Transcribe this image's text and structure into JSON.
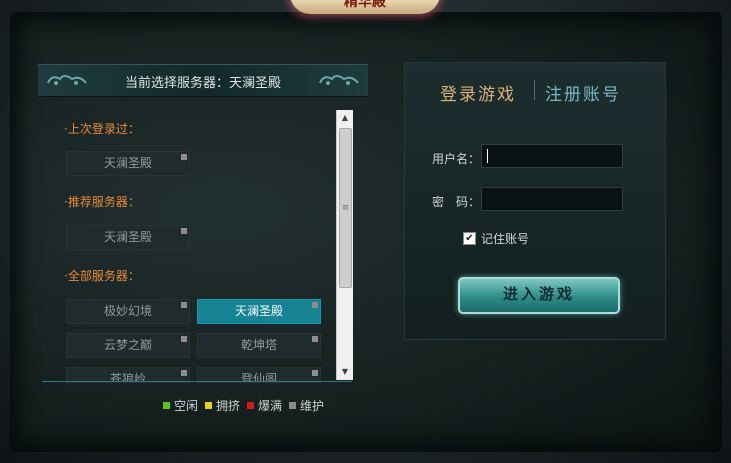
{
  "logo_text": "精华殿",
  "server_panel": {
    "title": "当前选择服务器：天澜圣殿",
    "last_login_label": "·上次登录过：",
    "recommended_label": "·推荐服务器：",
    "all_label": "·全部服务器：",
    "last_login": [
      {
        "name": "天澜圣殿"
      }
    ],
    "recommended": [
      {
        "name": "天澜圣殿"
      }
    ],
    "all_servers": [
      {
        "name": "极妙幻境",
        "selected": false
      },
      {
        "name": "天澜圣殿",
        "selected": true
      },
      {
        "name": "云梦之巅",
        "selected": false
      },
      {
        "name": "乾坤塔",
        "selected": false
      },
      {
        "name": "苍狼岭",
        "selected": false
      },
      {
        "name": "登仙阁",
        "selected": false
      }
    ]
  },
  "legend": [
    {
      "label": "空闲",
      "color": "#5ec21c"
    },
    {
      "label": "拥挤",
      "color": "#e3d21a"
    },
    {
      "label": "爆满",
      "color": "#d61818"
    },
    {
      "label": "维护",
      "color": "#8a8a8a"
    }
  ],
  "login": {
    "tab_login": "登录游戏",
    "tab_register": "注册账号",
    "username_label": "用户名：",
    "username_value": "",
    "password_label": "密　码：",
    "password_value": "",
    "remember_label": "记住账号",
    "remember_checked": true,
    "enter_button": "进入游戏"
  },
  "colors": {
    "accent": "#168394",
    "section_label": "#e88a3a",
    "tab_active": "#d8b27a",
    "tab_inactive": "#7ab7c6"
  }
}
